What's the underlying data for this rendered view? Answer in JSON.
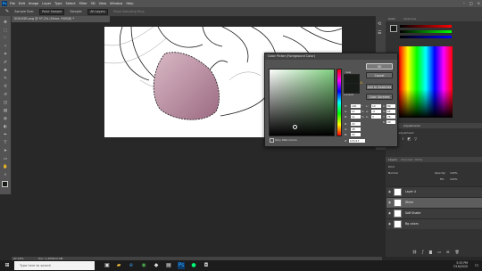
{
  "menubar": {
    "app_icon": "Ps",
    "items": [
      "File",
      "Edit",
      "Image",
      "Layer",
      "Type",
      "Select",
      "Filter",
      "3D",
      "View",
      "Window",
      "Help"
    ],
    "window_controls": [
      "–",
      "□",
      "×"
    ]
  },
  "options": {
    "sample_size_label": "Sample Size:",
    "sample_size_value": "Point Sample",
    "sample_label": "Sample:",
    "sample_value": "All Layers",
    "show_ring": "Show Sampling Ring"
  },
  "document": {
    "tab_title": "SOX-ESR.png @ 97.2% (Shine, RGB/8) *",
    "zoom": "97.23%",
    "status": "Doc: 1.87M/12.4M"
  },
  "color_picker": {
    "title": "Color Picker (Foreground Color)",
    "ok": "OK",
    "cancel": "Cancel",
    "add_swatches": "Add to Swatches",
    "color_libraries": "Color Libraries",
    "new_label": "new",
    "current_label": "current",
    "only_web": "Only Web Colors",
    "fields": {
      "H": "120",
      "S": "17",
      "B": "11",
      "R": "23",
      "G": "28",
      "Bv": "23",
      "L": "10",
      "a": "-4",
      "b": "3",
      "C": "80",
      "M": "65",
      "Y": "75",
      "K": "90",
      "hex": "171c17"
    },
    "units": {
      "H": "°",
      "S": "%",
      "B": "%"
    }
  },
  "panels": {
    "color_tab": "Color",
    "swatches_tab": "Swatches",
    "adjustments_tab": "Adjustments",
    "add_adjustment": "Add an adjustment",
    "layers_tab": "Layers",
    "channels_tab": "Channels",
    "paths_tab": "Paths",
    "kind_label": "Kind",
    "blend_mode": "Normal",
    "opacity_label": "Opacity:",
    "opacity_value": "100%",
    "fill_label": "Fill:",
    "fill_value": "100%",
    "layers": [
      {
        "name": "Layer 4",
        "selected": false
      },
      {
        "name": "Shine",
        "selected": true
      },
      {
        "name": "Soft Shade",
        "selected": false
      },
      {
        "name": "Bg colors",
        "selected": false
      }
    ]
  },
  "taskbar": {
    "search_placeholder": "Type here to search",
    "time": "3:33 PM",
    "date": "7/16/2020"
  },
  "colors": {
    "accent": "#31a8ff",
    "canvas_fill": "#c9a3b3",
    "foreground": "#171c17"
  }
}
